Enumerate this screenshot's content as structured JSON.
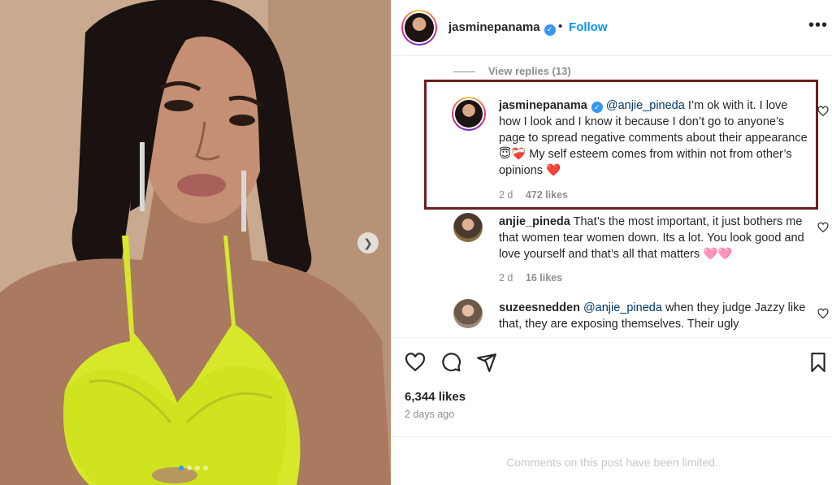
{
  "post": {
    "image_alt": "Selfie photo",
    "carousel_dots": 4,
    "active_dot": 0
  },
  "header": {
    "username": "jasminepanama",
    "separator": "•",
    "follow_label": "Follow",
    "more_label": "•••"
  },
  "comments": {
    "view_replies_label": "View replies (13)",
    "items": [
      {
        "username": "jasminepanama",
        "verified": true,
        "mention": "@anjie_pineda",
        "text": " I’m ok with it. I love how I look and I know it because I don’t go to anyone’s page to spread negative comments about their appearance 😇❤️‍🩹 My self esteem comes from within not from other’s opinions ❤️",
        "age": "2 d",
        "likes": "472 likes"
      },
      {
        "username": "anjie_pineda",
        "text": " That’s the most important, it just bothers me that women tear women down. Its a lot. You look good and love yourself and that’s all that matters 🩷🩷",
        "age": "2 d",
        "likes": "16 likes"
      },
      {
        "username": "suzeesnedden",
        "mention": "@anjie_pineda",
        "text": " when they judge Jazzy like that, they are exposing themselves. Their ugly"
      }
    ]
  },
  "actions": {
    "like_count": "6,344 likes",
    "time_ago": "2 days ago",
    "limited_notice": "Comments on this post have been limited."
  },
  "colors": {
    "accent": "#0095f6",
    "highlight_border": "#6b1f1f",
    "muted": "#8e8e8e"
  }
}
